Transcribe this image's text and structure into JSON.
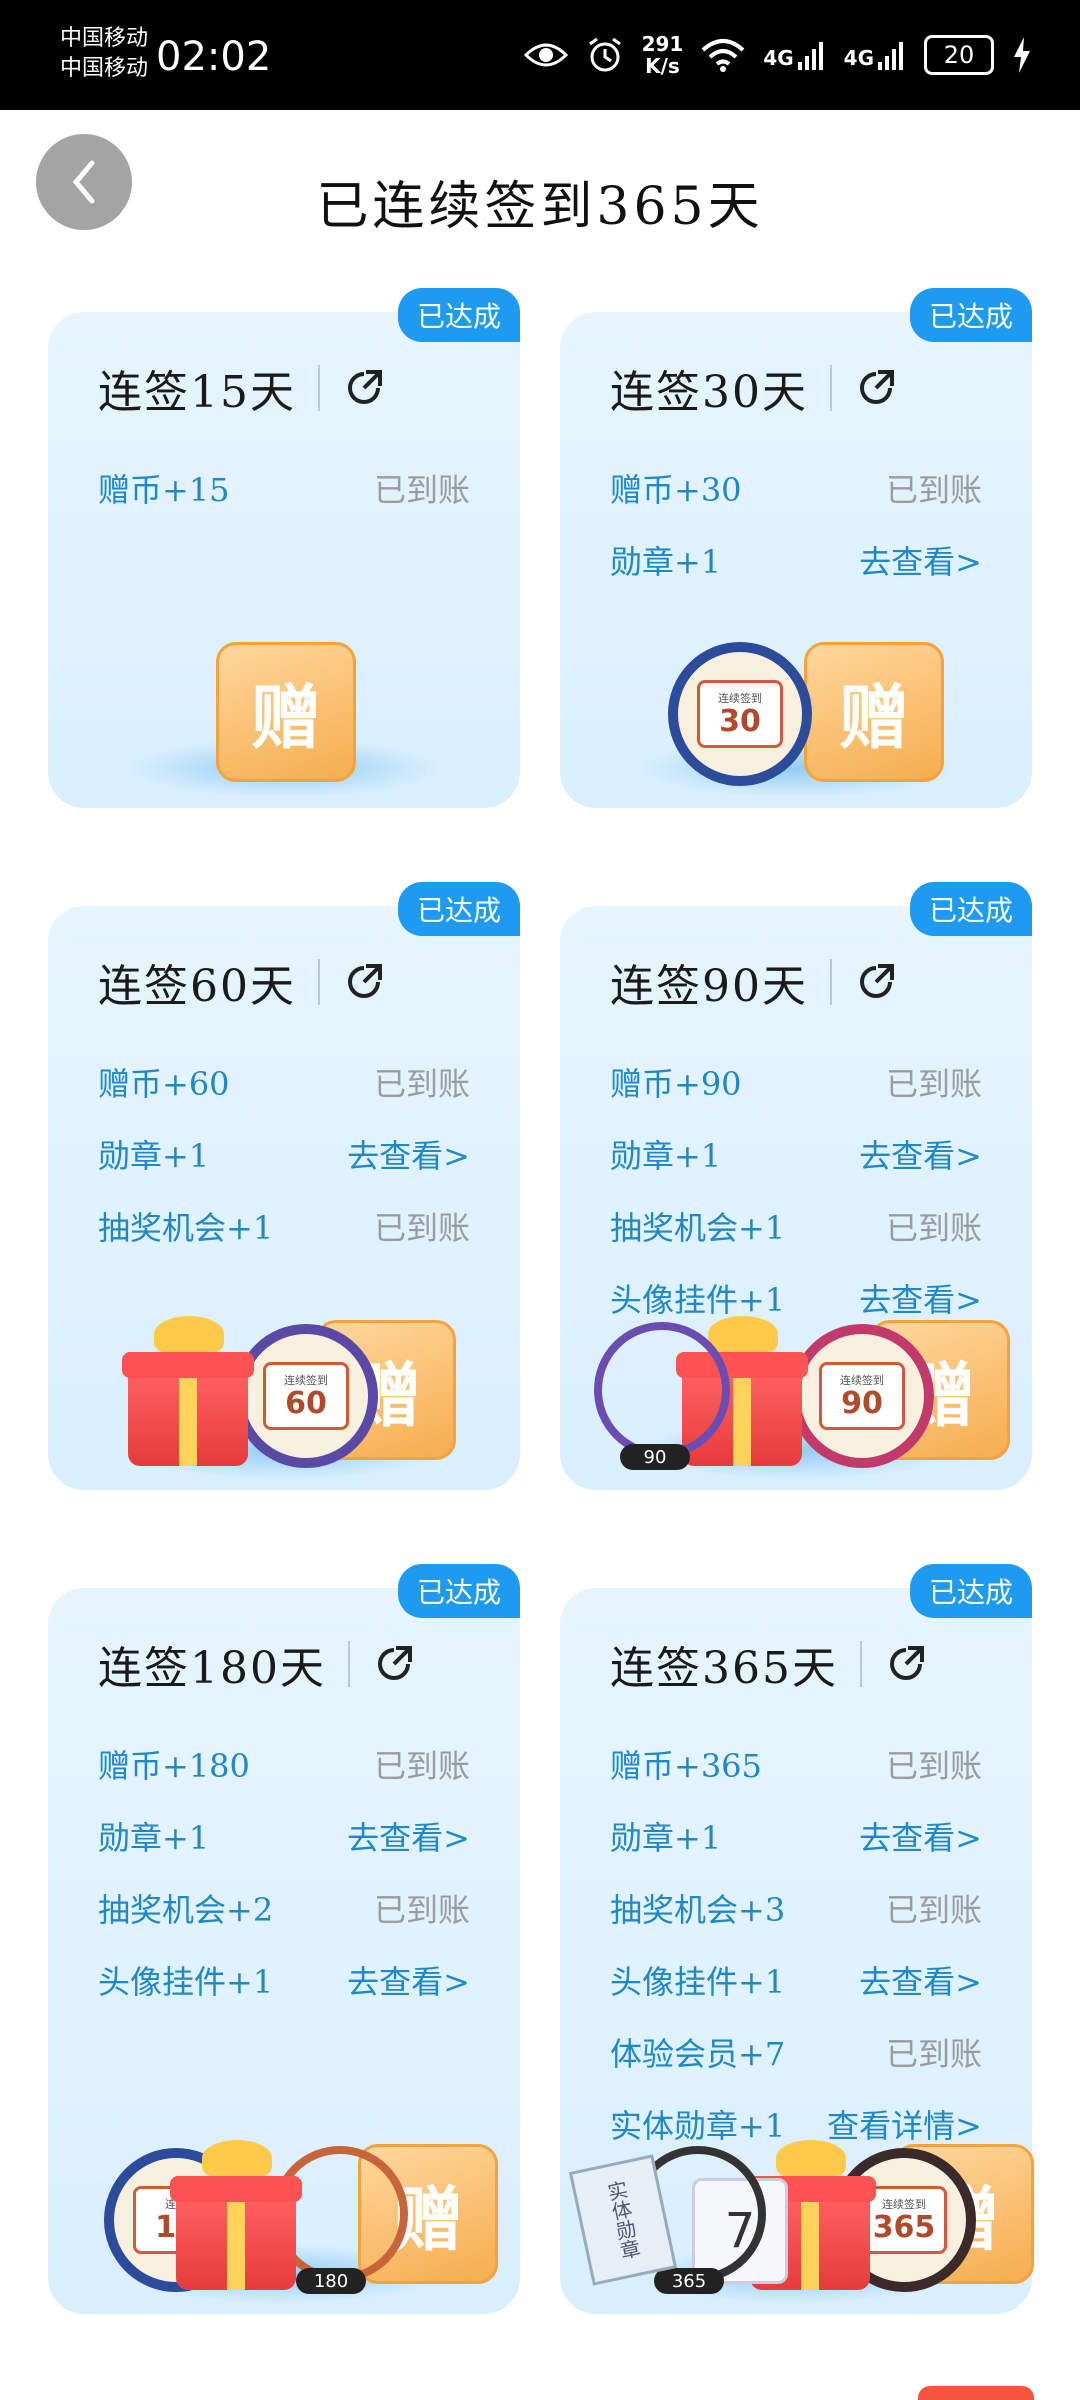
{
  "status_bar": {
    "carrier1": "中国移动",
    "carrier2": "中国移动",
    "time": "02:02",
    "net_speed_value": "291",
    "net_speed_unit": "K/s",
    "signal1": "4G",
    "signal2": "4G",
    "battery": "20"
  },
  "header": {
    "title": "已连续签到365天"
  },
  "cards": [
    {
      "title": "连签15天",
      "badge": "已达成",
      "rows": [
        {
          "label": "赠币+15",
          "status": "已到账"
        }
      ],
      "illustration": [
        "ticket"
      ],
      "ticket_text": "赠"
    },
    {
      "title": "连签30天",
      "badge": "已达成",
      "rows": [
        {
          "label": "赠币+30",
          "status": "已到账"
        },
        {
          "label": "勋章+1",
          "status": "去查看>"
        }
      ],
      "medal_top": "连续签到",
      "medal_num": "30",
      "ticket_text": "赠"
    },
    {
      "title": "连签60天",
      "badge": "已达成",
      "rows": [
        {
          "label": "赠币+60",
          "status": "已到账"
        },
        {
          "label": "勋章+1",
          "status": "去查看>"
        },
        {
          "label": "抽奖机会+1",
          "status": "已到账"
        }
      ],
      "medal_top": "连续签到",
      "medal_num": "60",
      "ticket_text": "赠"
    },
    {
      "title": "连签90天",
      "badge": "已达成",
      "rows": [
        {
          "label": "赠币+90",
          "status": "已到账"
        },
        {
          "label": "勋章+1",
          "status": "去查看>"
        },
        {
          "label": "抽奖机会+1",
          "status": "已到账"
        },
        {
          "label": "头像挂件+1",
          "status": "去查看>"
        }
      ],
      "medal_top": "连续签到",
      "medal_num": "90",
      "ring_tag": "90",
      "ticket_text": "赠"
    },
    {
      "title": "连签180天",
      "badge": "已达成",
      "rows": [
        {
          "label": "赠币+180",
          "status": "已到账"
        },
        {
          "label": "勋章+1",
          "status": "去查看>"
        },
        {
          "label": "抽奖机会+2",
          "status": "已到账"
        },
        {
          "label": "头像挂件+1",
          "status": "去查看>"
        }
      ],
      "medal_top": "连续",
      "medal_num": "18",
      "ring_tag": "180",
      "ticket_text": "赠"
    },
    {
      "title": "连签365天",
      "badge": "已达成",
      "rows": [
        {
          "label": "赠币+365",
          "status": "已到账"
        },
        {
          "label": "勋章+1",
          "status": "去查看>"
        },
        {
          "label": "抽奖机会+3",
          "status": "已到账"
        },
        {
          "label": "头像挂件+1",
          "status": "去查看>"
        },
        {
          "label": "体验会员+7",
          "status": "已到账"
        },
        {
          "label": "实体勋章+1",
          "status": "查看详情>"
        }
      ],
      "book_text": "实体勋章",
      "card_num": "7",
      "medal_top": "连续签到",
      "medal_num": "365",
      "ring_tag": "365",
      "ticket_text": "赠"
    }
  ],
  "colors": {
    "accent": "#1e9bf0",
    "link_text": "#2088c7",
    "muted_text": "#9b9b9b",
    "card_bg": "#e1f2ff"
  }
}
